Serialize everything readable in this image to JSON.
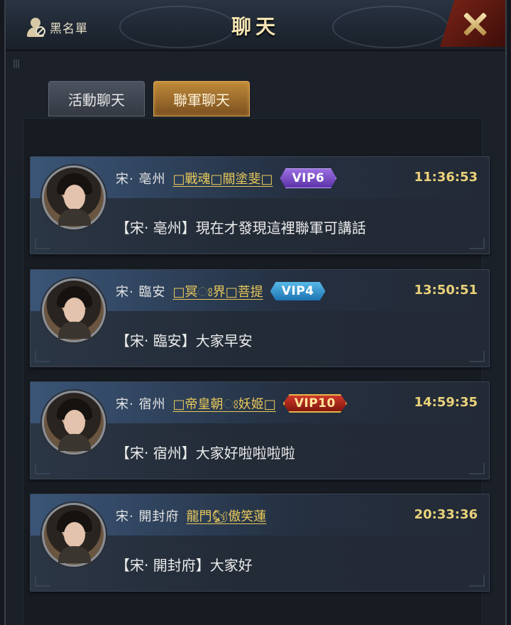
{
  "header": {
    "title": "聊天",
    "blacklist_label": "黑名單",
    "blacklist_icon": "blacklist-user-icon",
    "close_icon": "close-x-icon"
  },
  "tabs": [
    {
      "label": "活動聊天",
      "active": false
    },
    {
      "label": "聯軍聊天",
      "active": true
    }
  ],
  "messages": [
    {
      "region": "宋· 亳州",
      "name": "□戰魂□關塗斐□",
      "vip": "VIP6",
      "vip_style": "purple",
      "time": "11:36:53",
      "text": "【宋· 亳州】現在才發現這裡聯軍可講話"
    },
    {
      "region": "宋· 臨安",
      "name": "□冥ଃ界□菩提",
      "vip": "VIP4",
      "vip_style": "blue",
      "time": "13:50:51",
      "text": "【宋· 臨安】大家早安"
    },
    {
      "region": "宋· 宿州",
      "name": "□帝皇朝ଃ妖姬□",
      "vip": "VIP10",
      "vip_style": "red",
      "time": "14:59:35",
      "text": "【宋· 宿州】大家好啦啦啦啦"
    },
    {
      "region": "宋· 開封府",
      "name": "龍門🐿傲笑蓮",
      "vip": "",
      "vip_style": "",
      "time": "20:33:36",
      "text": "【宋· 開封府】大家好"
    }
  ],
  "colors": {
    "name": "#e8c95a",
    "time": "#ead27a",
    "tab_active": "#c08a3a"
  }
}
